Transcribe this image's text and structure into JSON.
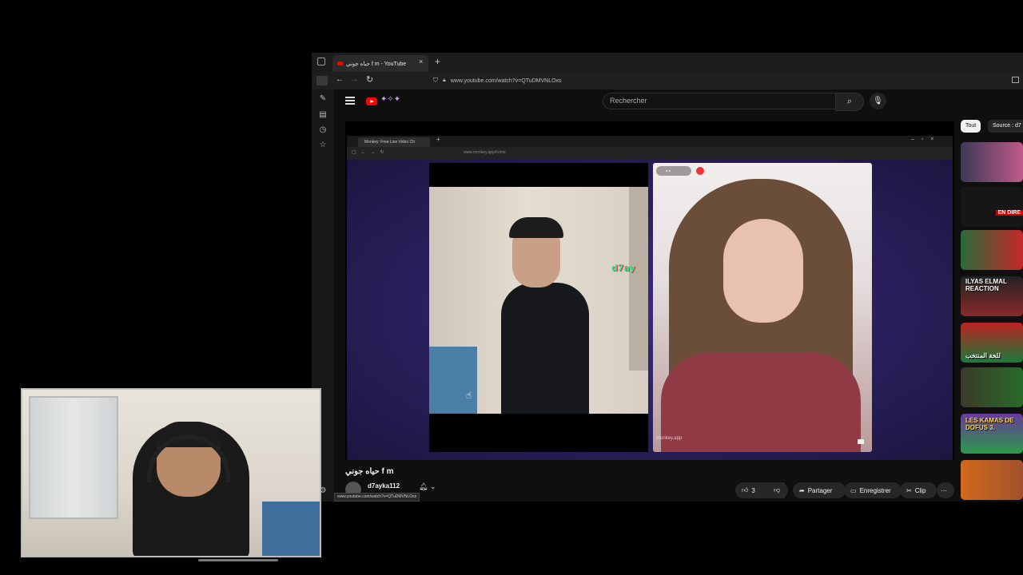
{
  "browser": {
    "tab_title": "حياه جوني f m - YouTube",
    "new_tab_symbol": "+",
    "url": "www.youtube.com/watch?v=QTuDMVNLOxs"
  },
  "youtube": {
    "search_placeholder": "Rechercher"
  },
  "inner_browser": {
    "tab_title": "Monkey: Free Live Video Ch",
    "url": "www.monkey.app/home",
    "tiktok_handle": "d7ay",
    "watermark": "monkey.app"
  },
  "video": {
    "title": "حياه جوني f m",
    "channel": "d7ayka112",
    "status_url": "www.youtube.com/watch?v=QTuDMVNLOxs"
  },
  "actions": {
    "likes": "3",
    "share": "Partager",
    "save": "Enregistrer",
    "clip": "Clip",
    "more": "⋯"
  },
  "rail": {
    "chips": [
      "Tout",
      "Source : d7"
    ],
    "thumb_texts": [
      "",
      "EN DIRE",
      "",
      "ILYAS ELMAL REACTION",
      "للخة المنتخب",
      "",
      "LES KAMAS DE DOFUS 3.",
      ""
    ]
  },
  "colors": {
    "youtube_red": "#ff0000",
    "stage_purple": "#2a1f5c",
    "page_bg": "#0f0f0f"
  }
}
